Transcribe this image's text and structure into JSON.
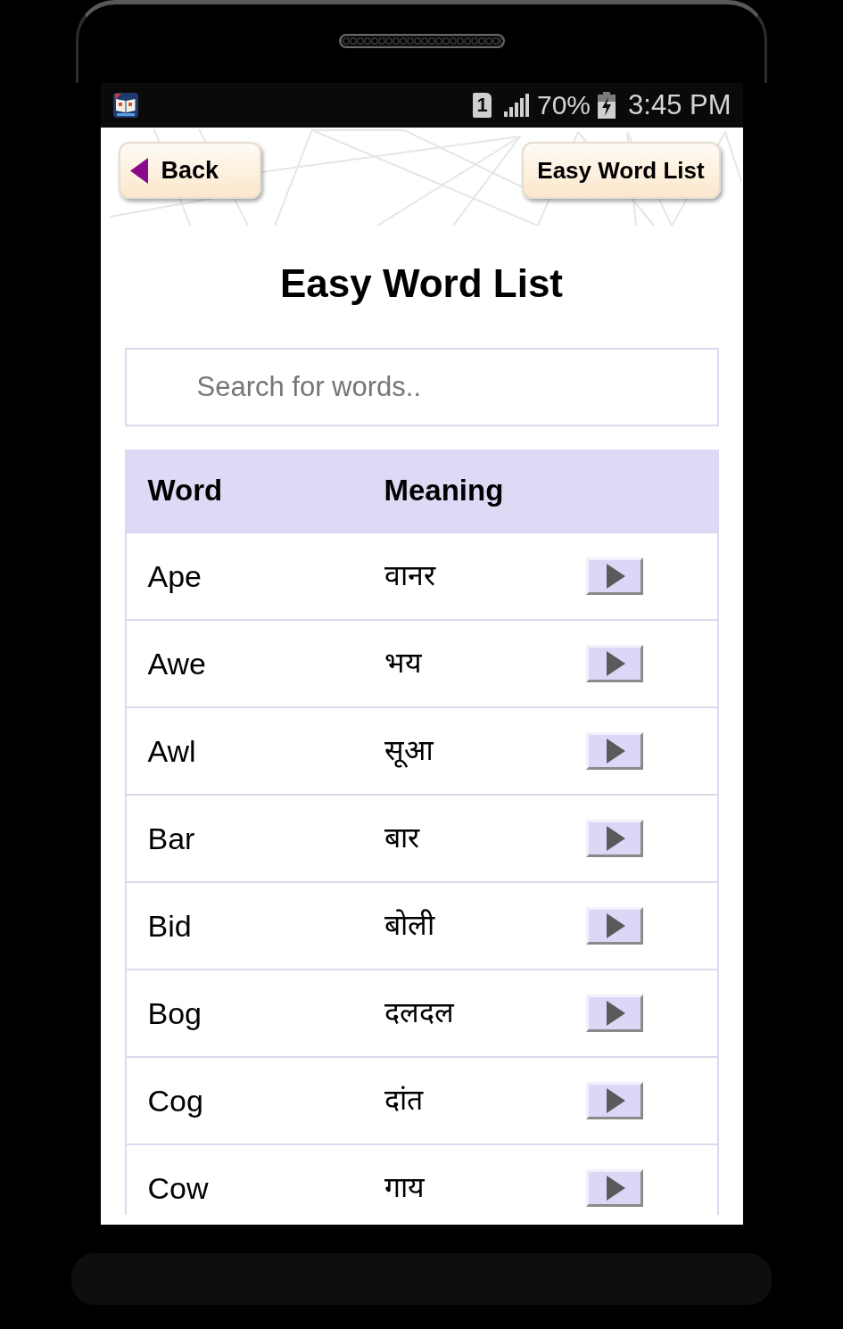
{
  "status_bar": {
    "sim_slot": "1",
    "battery": "70%",
    "time": "3:45 PM"
  },
  "header": {
    "back_button": "Back",
    "list_button": "Easy Word List"
  },
  "title": "Easy Word List",
  "search": {
    "placeholder": "Search for words.."
  },
  "table": {
    "columns": [
      "Word",
      "Meaning"
    ],
    "rows": [
      {
        "word": "Ape",
        "meaning": "वानर"
      },
      {
        "word": "Awe",
        "meaning": "भय"
      },
      {
        "word": "Awl",
        "meaning": "सूआ"
      },
      {
        "word": "Bar",
        "meaning": "बार"
      },
      {
        "word": "Bid",
        "meaning": "बोली"
      },
      {
        "word": "Bog",
        "meaning": "दलदल"
      },
      {
        "word": "Cog",
        "meaning": "दांत"
      },
      {
        "word": "Cow",
        "meaning": "गाय"
      }
    ]
  }
}
